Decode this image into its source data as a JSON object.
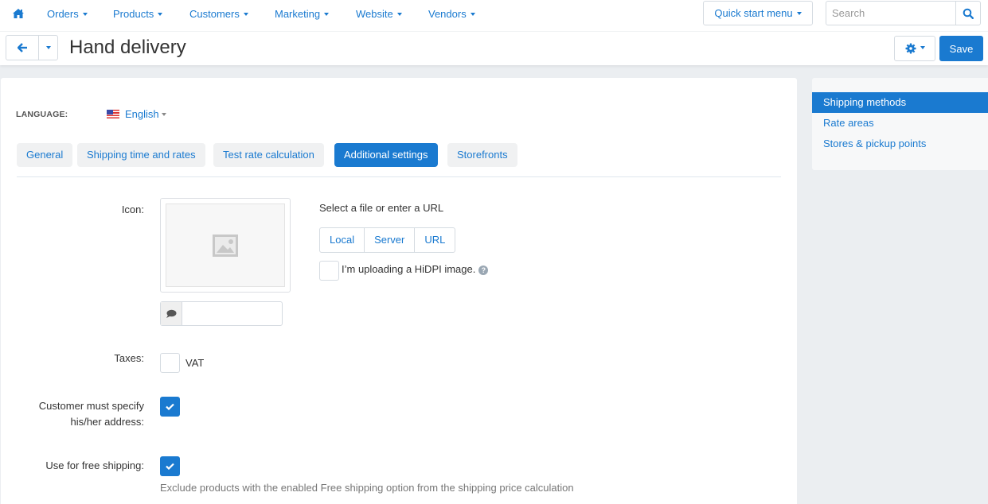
{
  "colors": {
    "accent": "#1a7ad0",
    "background": "#ebeef1",
    "tab_bg": "#f0f1f2"
  },
  "topnav": {
    "home_icon": "home-icon",
    "items": [
      {
        "label": "Orders"
      },
      {
        "label": "Products"
      },
      {
        "label": "Customers"
      },
      {
        "label": "Marketing"
      },
      {
        "label": "Website"
      },
      {
        "label": "Vendors"
      }
    ],
    "quick_start_label": "Quick start menu",
    "search": {
      "placeholder": "Search",
      "value": "",
      "icon": "search-icon"
    }
  },
  "header": {
    "back_icon": "arrow-left-icon",
    "title": "Hand delivery",
    "gear_icon": "gear-icon",
    "save_label": "Save"
  },
  "main": {
    "language": {
      "label": "LANGUAGE:",
      "value": "English",
      "flag": "us-flag-icon"
    },
    "tabs": [
      {
        "label": "General",
        "active": false
      },
      {
        "label": "Shipping time and rates",
        "active": false
      },
      {
        "label": "Test rate calculation",
        "active": false
      },
      {
        "label": "Additional settings",
        "active": true
      },
      {
        "label": "Storefronts",
        "active": false
      }
    ],
    "icon_field": {
      "label": "Icon:",
      "placeholder_icon": "image-placeholder-icon",
      "alt_icon": "comment-icon",
      "alt_value": "",
      "select_text": "Select a file or enter a URL",
      "sources": [
        "Local",
        "Server",
        "URL"
      ],
      "hidpi_label": "I’m uploading a HiDPI image.",
      "hidpi_checked": false,
      "help_icon": "question-circle-icon"
    },
    "taxes": {
      "label": "Taxes:",
      "options": [
        {
          "label": "VAT",
          "checked": false
        }
      ]
    },
    "customer_address": {
      "label_line1": "Customer must specify",
      "label_line2": "his/her address:",
      "checked": true
    },
    "free_shipping": {
      "label": "Use for free shipping:",
      "checked": true,
      "help": "Exclude products with the enabled Free shipping option from the shipping price calculation"
    }
  },
  "sidebar": {
    "items": [
      {
        "label": "Shipping methods",
        "active": true
      },
      {
        "label": "Rate areas",
        "active": false
      },
      {
        "label": "Stores & pickup points",
        "active": false
      }
    ]
  }
}
